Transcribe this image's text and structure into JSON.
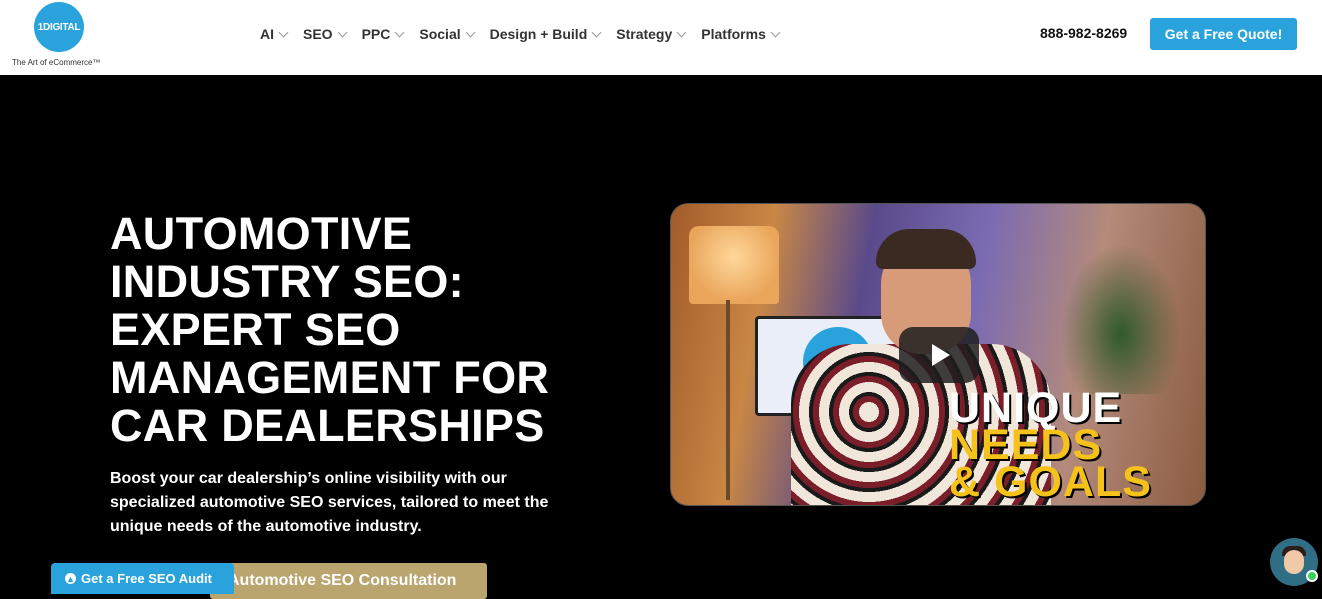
{
  "brand": {
    "logo_text": "1DIGITAL",
    "tagline": "The Art of eCommerce™",
    "accent_color": "#2aa3dd",
    "gold_color": "#b9a56d"
  },
  "nav": {
    "items": [
      {
        "label": "AI"
      },
      {
        "label": "SEO"
      },
      {
        "label": "PPC"
      },
      {
        "label": "Social"
      },
      {
        "label": "Design + Build"
      },
      {
        "label": "Strategy"
      },
      {
        "label": "Platforms"
      }
    ],
    "phone": "888-982-8269",
    "cta": "Get a Free Quote!"
  },
  "hero": {
    "title_lines": [
      "AUTOMOTIVE",
      "INDUSTRY SEO:",
      "EXPERT SEO",
      "MANAGEMENT FOR",
      "CAR DEALERSHIPS"
    ],
    "subtitle": "Boost your car dealership’s online visibility with our specialized automotive SEO services, tailored to meet the unique needs of the automotive industry.",
    "consult_button": "Automotive SEO Consultation",
    "audit_button": "Get a Free SEO Audit"
  },
  "video": {
    "monitor_logo": "1DIGITAL",
    "overlay_lines": [
      "UNIQUE",
      "NEEDS",
      "& GOALS"
    ]
  }
}
